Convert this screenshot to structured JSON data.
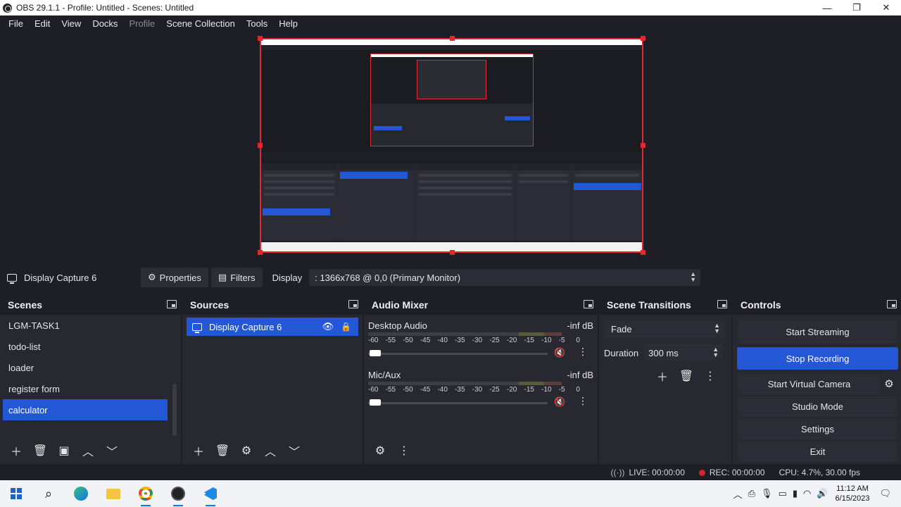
{
  "window": {
    "title": "OBS 29.1.1 - Profile: Untitled - Scenes: Untitled",
    "minimize": "—",
    "maximize": "❐",
    "close": "✕"
  },
  "menu": [
    "File",
    "Edit",
    "View",
    "Docks",
    "Profile",
    "Scene Collection",
    "Tools",
    "Help"
  ],
  "source_toolbar": {
    "source_name": "Display Capture 6",
    "properties_label": "Properties",
    "filters_label": "Filters",
    "display_label": "Display",
    "display_value": ": 1366x768 @ 0,0 (Primary Monitor)"
  },
  "scenes": {
    "title": "Scenes",
    "items": [
      "LGM-TASK1",
      "todo-list",
      "loader",
      "register form",
      "calculator"
    ],
    "selected": 4
  },
  "sources": {
    "title": "Sources",
    "items": [
      {
        "name": "Display Capture 6"
      }
    ]
  },
  "mixer": {
    "title": "Audio Mixer",
    "scale": [
      "-60",
      "-55",
      "-50",
      "-45",
      "-40",
      "-35",
      "-30",
      "-25",
      "-20",
      "-15",
      "-10",
      "-5",
      "0"
    ],
    "channels": [
      {
        "name": "Desktop Audio",
        "db": "-inf dB"
      },
      {
        "name": "Mic/Aux",
        "db": "-inf dB"
      }
    ]
  },
  "transitions": {
    "title": "Scene Transitions",
    "selected": "Fade",
    "duration_label": "Duration",
    "duration_value": "300 ms"
  },
  "controls": {
    "title": "Controls",
    "start_streaming": "Start Streaming",
    "stop_recording": "Stop Recording",
    "start_virtual_camera": "Start Virtual Camera",
    "studio_mode": "Studio Mode",
    "settings": "Settings",
    "exit": "Exit"
  },
  "status": {
    "live": "LIVE: 00:00:00",
    "rec": "REC: 00:00:00",
    "cpu": "CPU: 4.7%, 30.00 fps"
  },
  "taskbar": {
    "time": "11:12 AM",
    "date": "6/15/2023"
  },
  "colors": {
    "accent": "#2457d6",
    "record": "#d8242c",
    "selection_border": "#e3262f"
  }
}
